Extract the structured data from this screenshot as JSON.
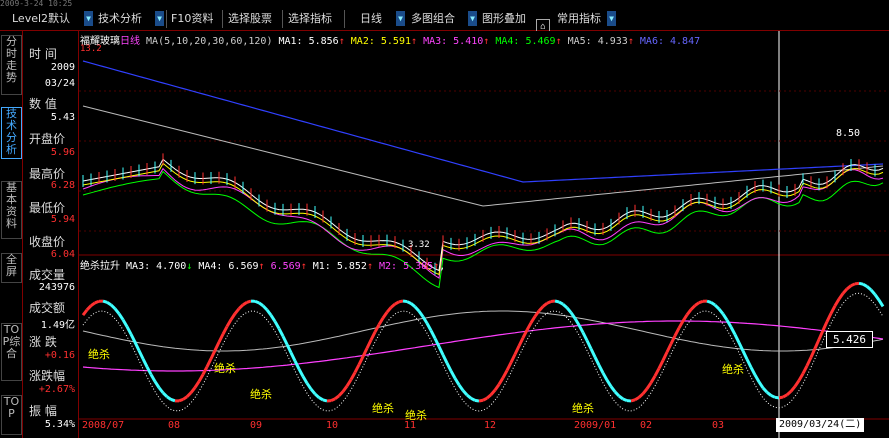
{
  "topstrip": "2009-3-24 10:25",
  "toolbar": {
    "level2": "Level2默认",
    "tech": "技术分析",
    "f10": "F10资料",
    "select_stock": "选择股票",
    "select_indicator": "选择指标",
    "daily": "日线",
    "multi": "多图组合",
    "overlay": "图形叠加",
    "common": "常用指标"
  },
  "left_tabs": [
    "分时走势",
    "技术分析",
    "基本资料",
    "全屏",
    "TOP综合",
    "TOP"
  ],
  "panel": {
    "time_label": "时 间",
    "date_year": "2009",
    "date_md": "03/24",
    "value_label": "数 值",
    "value": "5.43",
    "open_label": "开盘价",
    "open": "5.96",
    "high_label": "最高价",
    "high": "6.28",
    "low_label": "最低价",
    "low": "5.94",
    "close_label": "收盘价",
    "close": "6.04",
    "vol_label": "成交量",
    "vol": "243976",
    "amt_label": "成交额",
    "amt": "1.49亿",
    "chg_label": "涨 跌",
    "chg": "+0.16",
    "pct_label": "涨跌幅",
    "pct": "+2.67%",
    "amp_label": "振 幅",
    "amp": "5.34%"
  },
  "main_info": {
    "stock": "福耀玻璃",
    "period": "日线",
    "ma_def": "MA(5,10,20,30,60,120)",
    "ma1": "MA1: 5.856",
    "ma2": "MA2: 5.591",
    "ma3": "MA3: 5.410",
    "ma4": "MA4: 5.469",
    "ma5": "MA5: 4.933",
    "ma6": "MA6: 4.847",
    "price_scale_top": "13.2",
    "high_mark": "8.50",
    "low_mark": "3.32"
  },
  "sub_info": {
    "name": "绝杀拉升",
    "ma3": "MA3: 4.700",
    "ma4": "MA4: 6.569",
    "ma4b": "6.569",
    "m1": "M1: 5.852",
    "m2": "M2: 5.385",
    "value_box": "5.426",
    "signal": "绝杀"
  },
  "xaxis": {
    "labels": [
      "2008/07",
      "08",
      "09",
      "10",
      "11",
      "12",
      "2009/01",
      "02",
      "03"
    ],
    "current": "2009/03/24(二)"
  },
  "colors": {
    "frame": "#800000",
    "up": "#ff3030",
    "down": "#40ffff",
    "ma_white": "#ffffff",
    "ma_yellow": "#ffff00",
    "ma_magenta": "#ff40ff",
    "ma_green": "#00ff00",
    "ma_grey": "#bbbbbb",
    "ma_blue": "#3040ff"
  }
}
